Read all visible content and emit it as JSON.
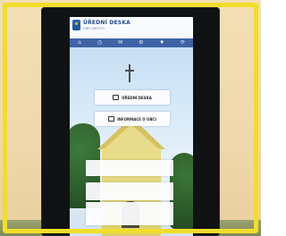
{
  "header": {
    "title": "ÚŘEDNÍ DESKA",
    "subtitle": "OBEC/MĚSTO"
  },
  "nav": {
    "items": [
      "⌂",
      "◷",
      "✉",
      "⚙",
      "♦",
      "⟳"
    ]
  },
  "buttons": {
    "uredni_deska": "ÚŘEDNÍ DESKA",
    "informace_o_obci": "INFORMACE O OBCI"
  },
  "colors": {
    "frame": "#f1dd2a",
    "header_text": "#234a8a",
    "nav_bar": "#3f64a5"
  }
}
